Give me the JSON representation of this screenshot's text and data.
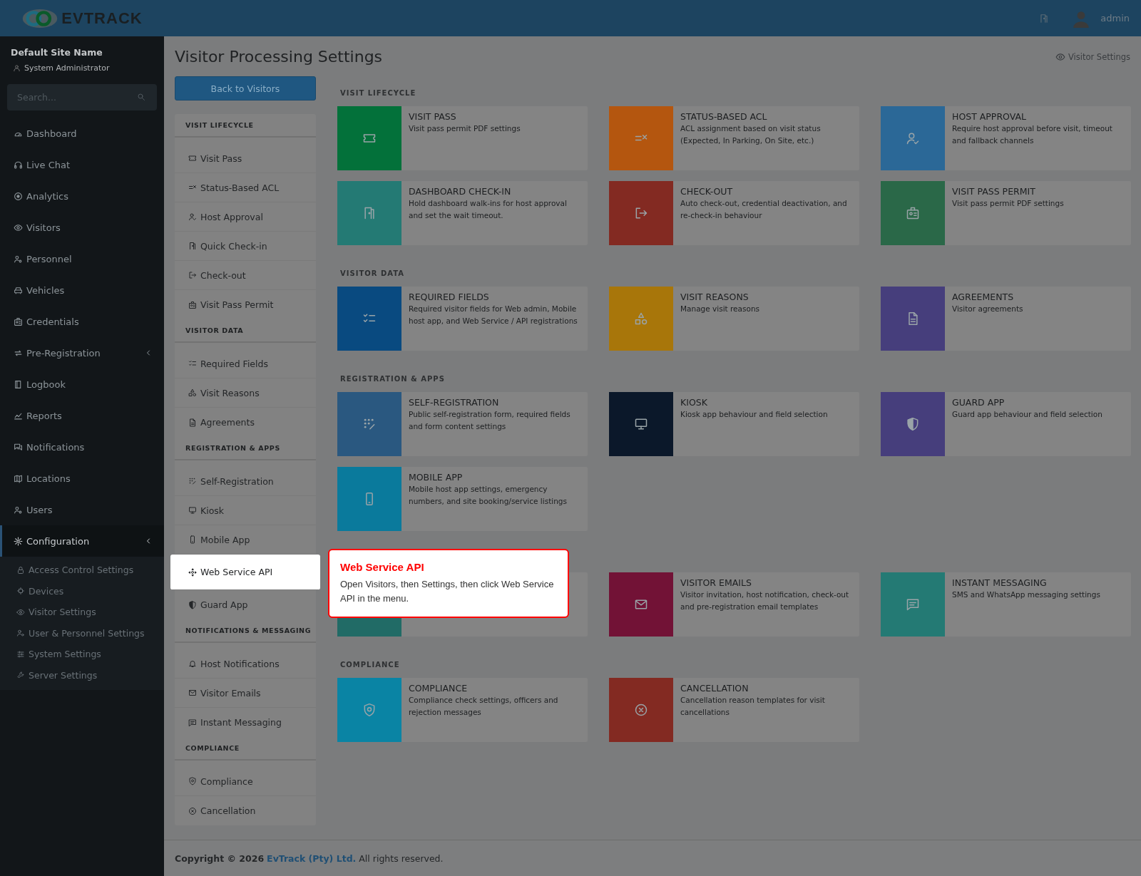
{
  "header": {
    "logo_text": "EVTRACK",
    "user": "admin"
  },
  "sidebar": {
    "site_name": "Default Site Name",
    "role": "System Administrator",
    "search": {
      "placeholder": "Search..."
    },
    "items": [
      {
        "label": "Dashboard",
        "active": false,
        "collapsible": false
      },
      {
        "label": "Live Chat",
        "active": false,
        "collapsible": false
      },
      {
        "label": "Analytics",
        "active": false,
        "collapsible": false
      },
      {
        "label": "Visitors",
        "active": false,
        "collapsible": false
      },
      {
        "label": "Personnel",
        "active": false,
        "collapsible": false
      },
      {
        "label": "Vehicles",
        "active": false,
        "collapsible": false
      },
      {
        "label": "Credentials",
        "active": false,
        "collapsible": false
      },
      {
        "label": "Pre-Registration",
        "active": false,
        "collapsible": true
      },
      {
        "label": "Logbook",
        "active": false,
        "collapsible": false
      },
      {
        "label": "Reports",
        "active": false,
        "collapsible": false
      },
      {
        "label": "Notifications",
        "active": false,
        "collapsible": false
      },
      {
        "label": "Locations",
        "active": false,
        "collapsible": false
      },
      {
        "label": "Users",
        "active": false,
        "collapsible": false
      },
      {
        "label": "Configuration",
        "active": true,
        "collapsible": true,
        "children": [
          {
            "label": "Access Control Settings"
          },
          {
            "label": "Devices"
          },
          {
            "label": "Visitor Settings"
          },
          {
            "label": "User & Personnel Settings"
          },
          {
            "label": "System Settings"
          },
          {
            "label": "Server Settings"
          }
        ]
      }
    ]
  },
  "page": {
    "title": "Visitor Processing Settings",
    "breadcrumb": "Visitor Settings",
    "back_button": "Back to Visitors"
  },
  "side_menu": [
    {
      "heading": "VISIT LIFECYCLE",
      "items": [
        {
          "label": "Visit Pass",
          "highlighted": false
        },
        {
          "label": "Status-Based ACL",
          "highlighted": false
        },
        {
          "label": "Host Approval",
          "highlighted": false
        },
        {
          "label": "Quick Check-in",
          "highlighted": false
        },
        {
          "label": "Check-out",
          "highlighted": false
        },
        {
          "label": "Visit Pass Permit",
          "highlighted": false
        }
      ]
    },
    {
      "heading": "VISITOR DATA",
      "items": [
        {
          "label": "Required Fields",
          "highlighted": false
        },
        {
          "label": "Visit Reasons",
          "highlighted": false
        },
        {
          "label": "Agreements",
          "highlighted": false
        }
      ]
    },
    {
      "heading": "REGISTRATION & APPS",
      "items": [
        {
          "label": "Self-Registration",
          "highlighted": false
        },
        {
          "label": "Kiosk",
          "highlighted": false
        },
        {
          "label": "Mobile App",
          "highlighted": false
        },
        {
          "label": "Web Service API",
          "highlighted": true
        },
        {
          "label": "Guard App",
          "highlighted": false
        }
      ]
    },
    {
      "heading": "NOTIFICATIONS & MESSAGING",
      "items": [
        {
          "label": "Host Notifications",
          "highlighted": false
        },
        {
          "label": "Visitor Emails",
          "highlighted": false
        },
        {
          "label": "Instant Messaging",
          "highlighted": false
        }
      ]
    },
    {
      "heading": "COMPLIANCE",
      "items": [
        {
          "label": "Compliance",
          "highlighted": false
        },
        {
          "label": "Cancellation",
          "highlighted": false
        }
      ]
    }
  ],
  "card_sections": [
    {
      "heading": "VISIT LIFECYCLE",
      "cards": [
        {
          "kind": "card",
          "title": "VISIT PASS",
          "description": "Visit pass permit PDF settings",
          "color": "#03713a"
        },
        {
          "kind": "card",
          "title": "STATUS-BASED ACL",
          "description": "ACL assignment based on visit status (Expected, In Parking, On Site, etc.)",
          "color": "#b4560f"
        },
        {
          "kind": "card",
          "title": "HOST APPROVAL",
          "description": "Require host approval before visit, timeout and fallback channels",
          "color": "#2b6897"
        },
        {
          "kind": "card",
          "title": "DASHBOARD CHECK-IN",
          "description": "Hold dashboard walk-ins for host approval and set the wait timeout.",
          "color": "#247a74"
        },
        {
          "kind": "card",
          "title": "CHECK-OUT",
          "description": "Auto check-out, credential deactivation, and re-check-in behaviour",
          "color": "#832a22"
        },
        {
          "kind": "card",
          "title": "VISIT PASS PERMIT",
          "description": "Visit pass permit PDF settings",
          "color": "#2a6848"
        }
      ]
    },
    {
      "heading": "VISITOR DATA",
      "cards": [
        {
          "kind": "card",
          "title": "REQUIRED FIELDS",
          "description": "Required visitor fields for Web admin, Mobile host app, and Web Service / API registrations",
          "color": "#094a80"
        },
        {
          "kind": "card",
          "title": "VISIT REASONS",
          "description": "Manage visit reasons",
          "color": "#a8760a"
        },
        {
          "kind": "card",
          "title": "AGREEMENTS",
          "description": "Visitor agreements",
          "color": "#463e7c"
        }
      ]
    },
    {
      "heading": "REGISTRATION & APPS",
      "cards": [
        {
          "kind": "card",
          "title": "SELF-REGISTRATION",
          "description": "Public self-registration form, required fields and form content settings",
          "color": "#2a5880"
        },
        {
          "kind": "card",
          "title": "KIOSK",
          "description": "Kiosk app behaviour and field selection",
          "color": "#0b182a"
        },
        {
          "kind": "card",
          "title": "GUARD APP",
          "description": "Guard app behaviour and field selection",
          "color": "#463e7c"
        },
        {
          "kind": "card",
          "title": "MOBILE APP",
          "description": "Mobile host app settings, emergency numbers, and site booking/service listings",
          "color": "#0a7a9c"
        }
      ]
    },
    {
      "cards": [
        {
          "kind": "covered",
          "color": "#216b66"
        },
        {
          "kind": "card",
          "title": "VISITOR EMAILS",
          "description": "Visitor invitation, host notification, check-out and pre-registration email templates",
          "color": "#721236"
        },
        {
          "kind": "card",
          "title": "INSTANT MESSAGING",
          "description": "SMS and WhatsApp messaging settings",
          "color": "#247a74"
        }
      ]
    },
    {
      "heading": "COMPLIANCE",
      "cards": [
        {
          "kind": "card",
          "title": "COMPLIANCE",
          "description": "Compliance check settings, officers and rejection messages",
          "color": "#0a84a4"
        },
        {
          "kind": "card",
          "title": "CANCELLATION",
          "description": "Cancellation reason templates for visit cancellations",
          "color": "#832a22"
        }
      ]
    }
  ],
  "tooltip": {
    "title": "Web Service API",
    "text": "Open Visitors, then Settings, then click Web Service API in the menu."
  },
  "footer": {
    "prefix": "Copyright © 2026",
    "company": "EvTrack (Pty) Ltd.",
    "suffix": "All rights reserved."
  }
}
